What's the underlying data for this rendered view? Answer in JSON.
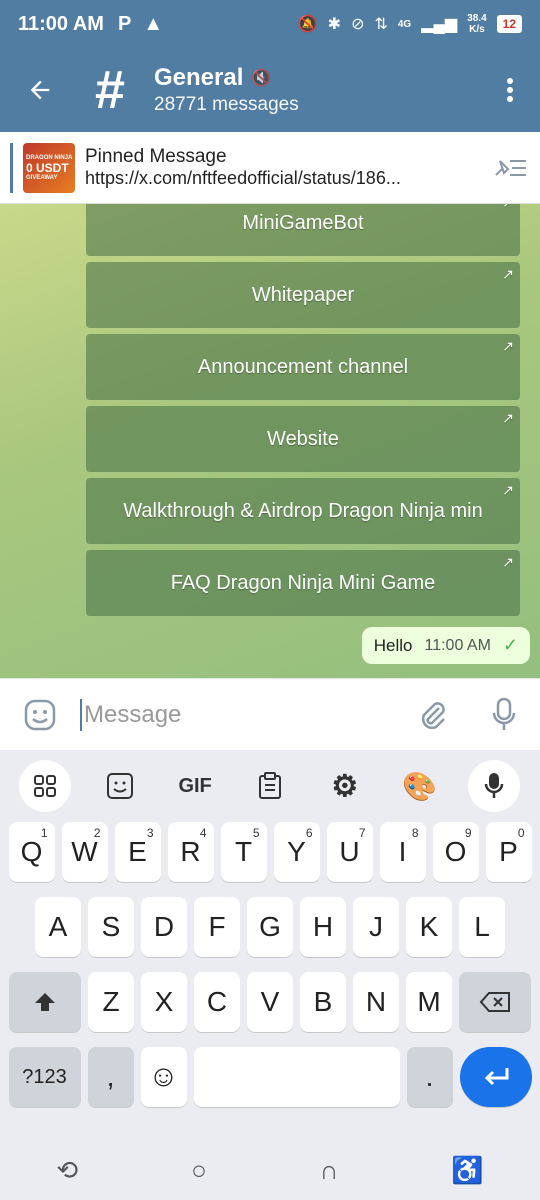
{
  "status_bar": {
    "time": "11:00 AM",
    "network_type": "4G",
    "speed_value": "38.4",
    "speed_unit": "K/s",
    "battery": "12"
  },
  "header": {
    "title": "General",
    "subtitle": "28771 messages"
  },
  "pinned": {
    "title": "Pinned Message",
    "link": "https://x.com/nftfeedofficial/status/186...",
    "thumb_line1": "DRAGON NINJA",
    "thumb_line2": "0 USDT",
    "thumb_line3": "GIVEAWAY"
  },
  "inline_buttons": [
    {
      "label": "MiniGameBot"
    },
    {
      "label": "Whitepaper"
    },
    {
      "label": "Announcement channel"
    },
    {
      "label": "Website"
    },
    {
      "label": "Walkthrough & Airdrop Dragon Ninja min"
    },
    {
      "label": "FAQ Dragon Ninja Mini Game"
    }
  ],
  "message": {
    "text": "Hello",
    "time": "11:00 AM"
  },
  "compose": {
    "placeholder": "Message"
  },
  "keyboard": {
    "toolbar": {
      "gif": "GIF"
    },
    "row1": [
      {
        "k": "Q",
        "h": "1"
      },
      {
        "k": "W",
        "h": "2"
      },
      {
        "k": "E",
        "h": "3"
      },
      {
        "k": "R",
        "h": "4"
      },
      {
        "k": "T",
        "h": "5"
      },
      {
        "k": "Y",
        "h": "6"
      },
      {
        "k": "U",
        "h": "7"
      },
      {
        "k": "I",
        "h": "8"
      },
      {
        "k": "O",
        "h": "9"
      },
      {
        "k": "P",
        "h": "0"
      }
    ],
    "row2": [
      "A",
      "S",
      "D",
      "F",
      "G",
      "H",
      "J",
      "K",
      "L"
    ],
    "row3": [
      "Z",
      "X",
      "C",
      "V",
      "B",
      "N",
      "M"
    ],
    "symbols": "?123",
    "comma": ",",
    "period": "."
  },
  "colors": {
    "header": "#517da2",
    "bubble": "#eeffde",
    "enter_key": "#1a73e8"
  }
}
